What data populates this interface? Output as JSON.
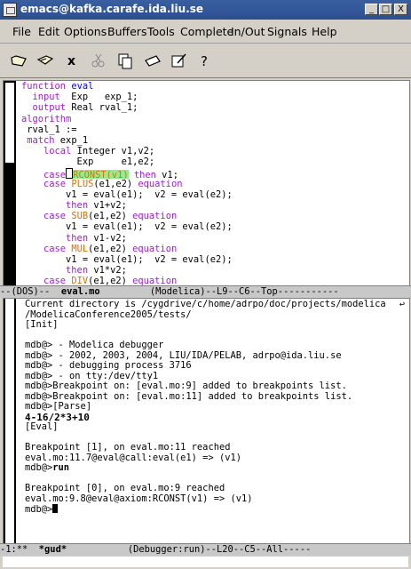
{
  "window": {
    "title": "emacs@kafka.carafe.ida.liu.se",
    "btn_min": "_",
    "btn_max": "□",
    "btn_close": "X"
  },
  "menu": [
    "File",
    "Edit",
    "Options",
    "Buffers",
    "Tools",
    "Complete",
    "In/Out",
    "Signals",
    "Help"
  ],
  "toolbar_icons": [
    "open-folder-icon",
    "open-file-icon",
    "close-x-icon",
    "cut-icon",
    "copy-icon",
    "paste-icon",
    "print-icon",
    "edit-icon",
    "help-icon"
  ],
  "toolbar_glyphs": {
    "close": "x",
    "help": "?"
  },
  "editor": {
    "lines": [
      [
        {
          "t": "function ",
          "c": "kw"
        },
        {
          "t": "eval",
          "c": "fn"
        }
      ],
      [
        {
          "t": "  "
        },
        {
          "t": "input",
          "c": "kw"
        },
        {
          "t": "  Exp   exp_1;"
        }
      ],
      [
        {
          "t": "  "
        },
        {
          "t": "output",
          "c": "kw"
        },
        {
          "t": " Real rval_1;"
        }
      ],
      [
        {
          "t": "algorithm",
          "c": "kw"
        }
      ],
      [
        {
          "t": " rval_1 :="
        }
      ],
      [
        {
          "t": " "
        },
        {
          "t": "match",
          "c": "kw"
        },
        {
          "t": " exp_1"
        }
      ],
      [
        {
          "t": "    "
        },
        {
          "t": "local",
          "c": "kw"
        },
        {
          "t": " Integer v1,v2;"
        }
      ],
      [
        {
          "t": "          Exp     e1,e2;"
        }
      ],
      [
        {
          "t": "    "
        },
        {
          "t": "case",
          "c": "kw"
        },
        {
          "t": "",
          "c": "cursorbox"
        },
        {
          "t": "RCONST(v1)",
          "c": "hl"
        },
        {
          "t": " "
        },
        {
          "t": "then",
          "c": "kw"
        },
        {
          "t": " v1;"
        }
      ],
      [
        {
          "t": "    "
        },
        {
          "t": "case",
          "c": "kw"
        },
        {
          "t": " "
        },
        {
          "t": "PLUS",
          "c": "bi"
        },
        {
          "t": "(e1,e2) "
        },
        {
          "t": "equation",
          "c": "kw"
        }
      ],
      [
        {
          "t": "        v1 = eval(e1);  v2 = eval(e2);"
        }
      ],
      [
        {
          "t": "        "
        },
        {
          "t": "then",
          "c": "kw"
        },
        {
          "t": " v1+v2;"
        }
      ],
      [
        {
          "t": "    "
        },
        {
          "t": "case",
          "c": "kw"
        },
        {
          "t": " "
        },
        {
          "t": "SUB",
          "c": "bi"
        },
        {
          "t": "(e1,e2) "
        },
        {
          "t": "equation",
          "c": "kw"
        }
      ],
      [
        {
          "t": "        v1 = eval(e1);  v2 = eval(e2);"
        }
      ],
      [
        {
          "t": "        "
        },
        {
          "t": "then",
          "c": "kw"
        },
        {
          "t": " v1-v2;"
        }
      ],
      [
        {
          "t": "    "
        },
        {
          "t": "case",
          "c": "kw"
        },
        {
          "t": " "
        },
        {
          "t": "MUL",
          "c": "bi"
        },
        {
          "t": "(e1,e2) "
        },
        {
          "t": "equation",
          "c": "kw"
        }
      ],
      [
        {
          "t": "        v1 = eval(e1);  v2 = eval(e2);"
        }
      ],
      [
        {
          "t": "        "
        },
        {
          "t": "then",
          "c": "kw"
        },
        {
          "t": " v1*v2;"
        }
      ],
      [
        {
          "t": "    "
        },
        {
          "t": "case",
          "c": "kw"
        },
        {
          "t": " "
        },
        {
          "t": "DIV",
          "c": "bi"
        },
        {
          "t": "(e1,e2) "
        },
        {
          "t": "equation",
          "c": "kw"
        }
      ]
    ]
  },
  "modeline1": {
    "prefix": "--(DOS)--  ",
    "buffer": "eval.mo",
    "rest": "         (Modelica)--L9--C6--Top-----------"
  },
  "repl": {
    "lines": [
      {
        "t": "Current directory is /cygdrive/c/home/adrpo/doc/projects/modelica",
        "wrap": true
      },
      {
        "t": "/ModelicaConference2005/tests/"
      },
      {
        "t": "[Init]"
      },
      {
        "t": ""
      },
      {
        "t": "mdb@> - Modelica debugger"
      },
      {
        "t": "mdb@> - 2002, 2003, 2004, LIU/IDA/PELAB, adrpo@ida.liu.se"
      },
      {
        "t": "mdb@> - debugging process 3716"
      },
      {
        "t": "mdb@> - on tty:/dev/tty1"
      },
      {
        "t": "mdb@>Breakpoint on: [eval.mo:9] added to breakpoints list."
      },
      {
        "t": "mdb@>Breakpoint on: [eval.mo:11] added to breakpoints list."
      },
      {
        "t": "mdb@>[Parse]"
      },
      {
        "t": "4-16/2*3+10",
        "bold": true
      },
      {
        "t": "[Eval]"
      },
      {
        "t": ""
      },
      {
        "t": "Breakpoint [1], on eval.mo:11 reached"
      },
      {
        "t": "eval.mo:11.7@eval@call:eval(e1) => (v1)"
      },
      {
        "t": "mdb@>",
        "cmd": "run"
      },
      {
        "t": ""
      },
      {
        "t": "Breakpoint [0], on eval.mo:9 reached"
      },
      {
        "t": "eval.mo:9.8@eval@axiom:RCONST(v1) => (v1)"
      },
      {
        "t": "mdb@>",
        "cursor": true
      }
    ],
    "wrap_glyph": "↩"
  },
  "modeline2": {
    "prefix": "-1:**  ",
    "buffer": "*gud*",
    "rest": "           (Debugger:run)--L20--C5--All-----"
  }
}
